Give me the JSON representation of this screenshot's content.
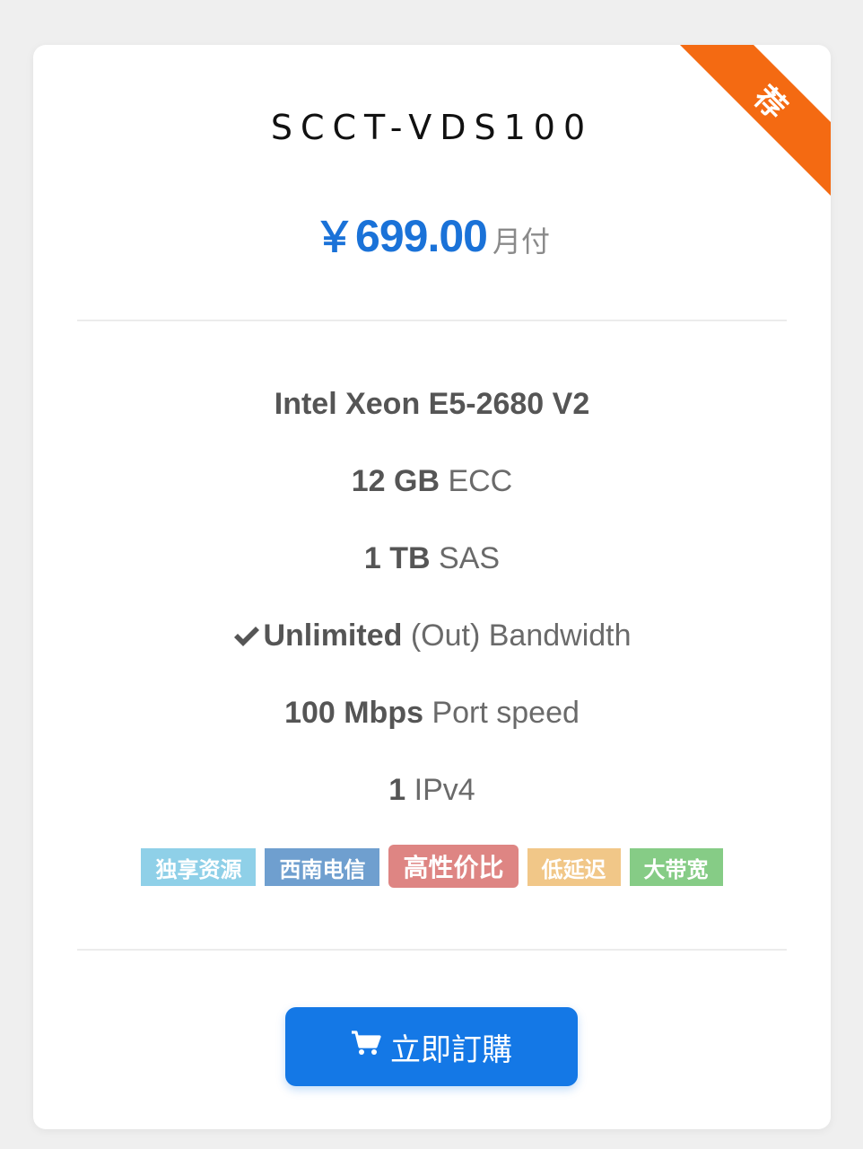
{
  "plan": {
    "name": "SCCT-VDS100",
    "ribbon_label": "荐",
    "ribbon_color": "#f46a12"
  },
  "price": {
    "currency": "￥",
    "amount": "699.00",
    "period": "月付",
    "color": "#1a72d8"
  },
  "specs": {
    "cpu": "Intel Xeon E5-2680 V2",
    "memory_value": "12 GB",
    "memory_type": "ECC",
    "disk_value": "1 TB",
    "disk_type": "SAS",
    "bandwidth_bold": "Unlimited",
    "bandwidth_rest": "(Out) Bandwidth",
    "port_value": "100 Mbps",
    "port_label": "Port speed",
    "ip_value": "1",
    "ip_label": "IPv4"
  },
  "tags": [
    {
      "label": "独享资源",
      "color": "#8fd0e8"
    },
    {
      "label": "西南电信",
      "color": "#6f9fcf"
    },
    {
      "label": "高性价比",
      "color": "#de8583"
    },
    {
      "label": "低延迟",
      "color": "#f1c788"
    },
    {
      "label": "大带宽",
      "color": "#86cc86"
    }
  ],
  "order": {
    "label": "立即訂購",
    "icon": "cart-icon",
    "color": "#1478e6"
  }
}
